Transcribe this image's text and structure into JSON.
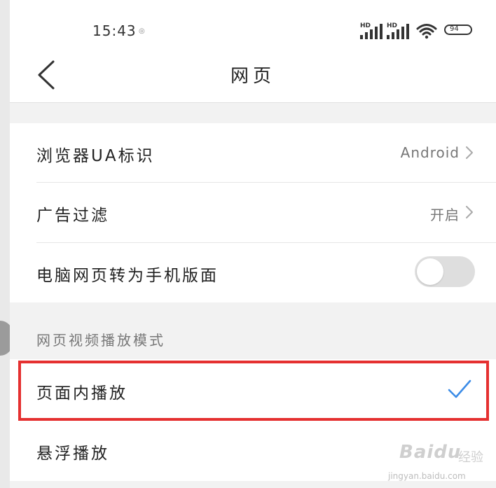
{
  "status_bar": {
    "time": "15:43",
    "signal_1_label": "HD",
    "signal_2_label": "HD",
    "battery": "94"
  },
  "header": {
    "title": "网页",
    "back_icon": "chevron-left-icon"
  },
  "settings": {
    "browser_ua": {
      "label": "浏览器UA标识",
      "value": "Android"
    },
    "ad_filter": {
      "label": "广告过滤",
      "value": "开启"
    },
    "desktop_to_mobile": {
      "label": "电脑网页转为手机版面",
      "enabled": false
    }
  },
  "video_mode": {
    "section_title": "网页视频播放模式",
    "options": [
      {
        "label": "页面内播放",
        "selected": true
      },
      {
        "label": "悬浮播放",
        "selected": false
      }
    ]
  },
  "watermark": {
    "brand": "Baidu",
    "brand_cn": "经验",
    "url": "jingyan.baidu.com"
  },
  "colors": {
    "highlight": "#e53030",
    "check": "#3c8ce7",
    "toggle_off": "#dedede"
  }
}
